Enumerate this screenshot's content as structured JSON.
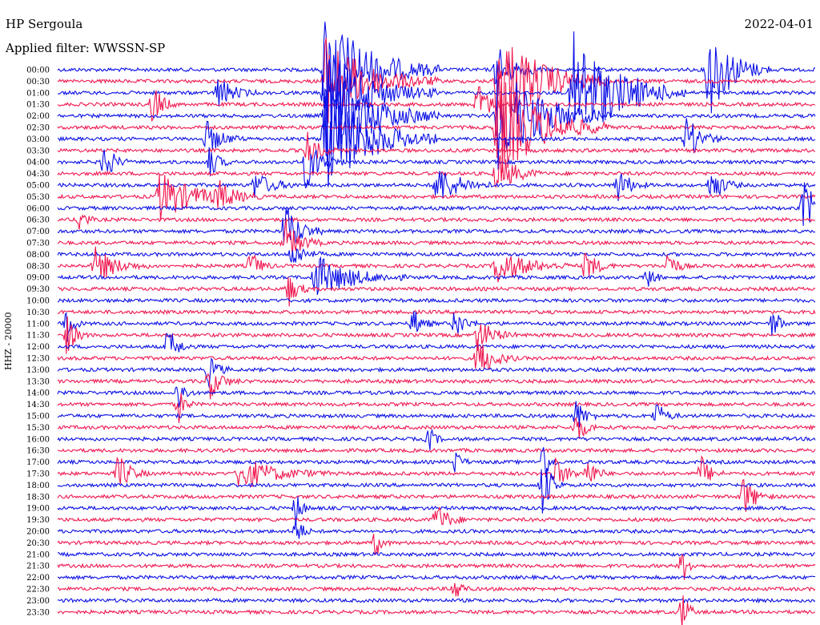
{
  "header": {
    "station": "HP Sergoula",
    "date": "2022-04-01",
    "filter_label": "Applied filter: WWSSN-SP"
  },
  "channel_label": "HHZ - 20000",
  "colors": {
    "trace_a": "#0a0fe6",
    "trace_b": "#f0174f"
  },
  "chart_data": {
    "type": "line",
    "title": "HP Sergoula",
    "date": "2022-04-01",
    "filter": "WWSSN-SP",
    "ylabel": "HHZ - 20000",
    "row_interval_minutes": 30,
    "row_labels": [
      "00:00",
      "00:30",
      "01:00",
      "01:30",
      "02:00",
      "02:30",
      "03:00",
      "03:30",
      "04:00",
      "04:30",
      "05:00",
      "05:30",
      "06:00",
      "06:30",
      "07:00",
      "07:30",
      "08:00",
      "08:30",
      "09:00",
      "09:30",
      "10:00",
      "10:30",
      "11:00",
      "11:30",
      "12:00",
      "12:30",
      "13:00",
      "13:30",
      "14:00",
      "14:30",
      "15:00",
      "15:30",
      "16:00",
      "16:30",
      "17:00",
      "17:30",
      "18:00",
      "18:30",
      "19:00",
      "19:30",
      "20:00",
      "20:30",
      "21:00",
      "21:30",
      "22:00",
      "22:30",
      "23:00",
      "23:30"
    ],
    "series": [
      {
        "name": "even rows",
        "color": "#0a0fe6"
      },
      {
        "name": "odd rows",
        "color": "#f0174f"
      }
    ],
    "x": [
      0,
      30
    ],
    "x_unit": "minutes within row",
    "events": [
      {
        "row": 0,
        "t": 0.353,
        "amp": 5.5,
        "dur": 0.15
      },
      {
        "row": 0,
        "t": 0.58,
        "amp": 2.5,
        "dur": 0.06
      },
      {
        "row": 0,
        "t": 0.859,
        "amp": 4.5,
        "dur": 0.08
      },
      {
        "row": 1,
        "t": 0.353,
        "amp": 4.0,
        "dur": 0.15
      },
      {
        "row": 1,
        "t": 0.58,
        "amp": 5.0,
        "dur": 0.15
      },
      {
        "row": 2,
        "t": 0.353,
        "amp": 4.0,
        "dur": 0.15
      },
      {
        "row": 2,
        "t": 0.212,
        "amp": 1.5,
        "dur": 0.05
      },
      {
        "row": 2,
        "t": 0.68,
        "amp": 5.5,
        "dur": 0.15
      },
      {
        "row": 2,
        "t": 0.765,
        "amp": 1.5,
        "dur": 0.03
      },
      {
        "row": 3,
        "t": 0.126,
        "amp": 2.0,
        "dur": 0.03
      },
      {
        "row": 3,
        "t": 0.555,
        "amp": 2.0,
        "dur": 0.04
      },
      {
        "row": 4,
        "t": 0.353,
        "amp": 5.0,
        "dur": 0.15
      },
      {
        "row": 4,
        "t": 0.58,
        "amp": 5.0,
        "dur": 0.15
      },
      {
        "row": 5,
        "t": 0.58,
        "amp": 5.0,
        "dur": 0.15
      },
      {
        "row": 6,
        "t": 0.197,
        "amp": 1.5,
        "dur": 0.05
      },
      {
        "row": 6,
        "t": 0.353,
        "amp": 5.0,
        "dur": 0.15
      },
      {
        "row": 6,
        "t": 0.83,
        "amp": 2.0,
        "dur": 0.05
      },
      {
        "row": 7,
        "t": 0.33,
        "amp": 1.5,
        "dur": 0.04
      },
      {
        "row": 8,
        "t": 0.062,
        "amp": 2.0,
        "dur": 0.03
      },
      {
        "row": 8,
        "t": 0.2,
        "amp": 1.5,
        "dur": 0.03
      },
      {
        "row": 8,
        "t": 0.328,
        "amp": 2.5,
        "dur": 0.05
      },
      {
        "row": 9,
        "t": 0.58,
        "amp": 2.0,
        "dur": 0.06
      },
      {
        "row": 10,
        "t": 0.26,
        "amp": 1.2,
        "dur": 0.06
      },
      {
        "row": 10,
        "t": 0.5,
        "amp": 1.8,
        "dur": 0.08
      },
      {
        "row": 10,
        "t": 0.74,
        "amp": 1.5,
        "dur": 0.04
      },
      {
        "row": 10,
        "t": 0.863,
        "amp": 1.6,
        "dur": 0.04
      },
      {
        "row": 11,
        "t": 0.135,
        "amp": 2.2,
        "dur": 0.12
      },
      {
        "row": 11,
        "t": 0.21,
        "amp": 1.6,
        "dur": 0.06
      },
      {
        "row": 12,
        "t": 0.985,
        "amp": 2.2,
        "dur": 0.06
      },
      {
        "row": 13,
        "t": 0.03,
        "amp": 1.3,
        "dur": 0.02
      },
      {
        "row": 14,
        "t": 0.3,
        "amp": 2.5,
        "dur": 0.05
      },
      {
        "row": 15,
        "t": 0.3,
        "amp": 2.0,
        "dur": 0.05
      },
      {
        "row": 16,
        "t": 0.31,
        "amp": 1.2,
        "dur": 0.04
      },
      {
        "row": 17,
        "t": 0.05,
        "amp": 1.6,
        "dur": 0.07
      },
      {
        "row": 17,
        "t": 0.255,
        "amp": 1.4,
        "dur": 0.03
      },
      {
        "row": 17,
        "t": 0.58,
        "amp": 1.6,
        "dur": 0.1
      },
      {
        "row": 17,
        "t": 0.697,
        "amp": 1.4,
        "dur": 0.04
      },
      {
        "row": 17,
        "t": 0.805,
        "amp": 1.4,
        "dur": 0.03
      },
      {
        "row": 18,
        "t": 0.34,
        "amp": 2.0,
        "dur": 0.12
      },
      {
        "row": 18,
        "t": 0.78,
        "amp": 1.2,
        "dur": 0.02
      },
      {
        "row": 19,
        "t": 0.305,
        "amp": 1.5,
        "dur": 0.03
      },
      {
        "row": 22,
        "t": 0.012,
        "amp": 2.0,
        "dur": 0.02
      },
      {
        "row": 22,
        "t": 0.47,
        "amp": 1.3,
        "dur": 0.03
      },
      {
        "row": 22,
        "t": 0.525,
        "amp": 1.4,
        "dur": 0.03
      },
      {
        "row": 22,
        "t": 0.945,
        "amp": 1.6,
        "dur": 0.02
      },
      {
        "row": 23,
        "t": 0.012,
        "amp": 1.8,
        "dur": 0.03
      },
      {
        "row": 23,
        "t": 0.555,
        "amp": 1.5,
        "dur": 0.05
      },
      {
        "row": 24,
        "t": 0.146,
        "amp": 1.8,
        "dur": 0.03
      },
      {
        "row": 25,
        "t": 0.555,
        "amp": 2.0,
        "dur": 0.05
      },
      {
        "row": 26,
        "t": 0.2,
        "amp": 1.4,
        "dur": 0.03
      },
      {
        "row": 27,
        "t": 0.2,
        "amp": 1.6,
        "dur": 0.04
      },
      {
        "row": 28,
        "t": 0.16,
        "amp": 1.6,
        "dur": 0.02
      },
      {
        "row": 29,
        "t": 0.16,
        "amp": 1.5,
        "dur": 0.02
      },
      {
        "row": 30,
        "t": 0.685,
        "amp": 1.5,
        "dur": 0.03
      },
      {
        "row": 30,
        "t": 0.79,
        "amp": 1.3,
        "dur": 0.03
      },
      {
        "row": 31,
        "t": 0.685,
        "amp": 1.5,
        "dur": 0.03
      },
      {
        "row": 32,
        "t": 0.49,
        "amp": 1.2,
        "dur": 0.02
      },
      {
        "row": 34,
        "t": 0.525,
        "amp": 1.1,
        "dur": 0.02
      },
      {
        "row": 34,
        "t": 0.64,
        "amp": 2.5,
        "dur": 0.02
      },
      {
        "row": 35,
        "t": 0.08,
        "amp": 1.7,
        "dur": 0.04
      },
      {
        "row": 35,
        "t": 0.24,
        "amp": 1.5,
        "dur": 0.12
      },
      {
        "row": 35,
        "t": 0.655,
        "amp": 1.6,
        "dur": 0.04
      },
      {
        "row": 35,
        "t": 0.7,
        "amp": 1.4,
        "dur": 0.03
      },
      {
        "row": 35,
        "t": 0.85,
        "amp": 1.5,
        "dur": 0.03
      },
      {
        "row": 36,
        "t": 0.64,
        "amp": 2.8,
        "dur": 0.03
      },
      {
        "row": 37,
        "t": 0.905,
        "amp": 1.8,
        "dur": 0.04
      },
      {
        "row": 38,
        "t": 0.315,
        "amp": 1.5,
        "dur": 0.02
      },
      {
        "row": 39,
        "t": 0.5,
        "amp": 1.5,
        "dur": 0.04
      },
      {
        "row": 40,
        "t": 0.315,
        "amp": 1.6,
        "dur": 0.02
      },
      {
        "row": 41,
        "t": 0.42,
        "amp": 1.2,
        "dur": 0.02
      },
      {
        "row": 43,
        "t": 0.825,
        "amp": 1.6,
        "dur": 0.02
      },
      {
        "row": 45,
        "t": 0.525,
        "amp": 1.3,
        "dur": 0.02
      },
      {
        "row": 47,
        "t": 0.825,
        "amp": 2.0,
        "dur": 0.02
      }
    ]
  }
}
